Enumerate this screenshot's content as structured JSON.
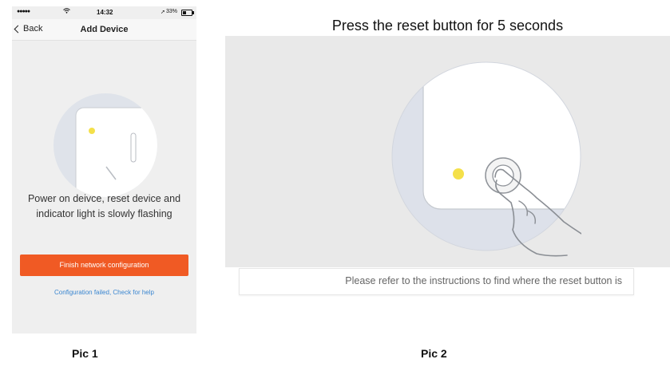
{
  "pic1": {
    "status": {
      "signal": "●●●●●",
      "time": "14:32",
      "battery": "33%"
    },
    "nav": {
      "back_label": "Back",
      "title": "Add Device"
    },
    "message_line1": "Power on deivce, reset device and",
    "message_line2": "indicator light is slowly flashing",
    "finish_button": "Finish network configuration",
    "help_link": "Configuration failed,  Check for help",
    "caption": "Pic 1",
    "accent": "#f05a24",
    "link_color": "#3a86d0",
    "indicator_color": "#f4e04a"
  },
  "pic2": {
    "title": "Press the reset button for 5 seconds",
    "instruction": "Please refer to the instructions to find where the reset button is",
    "caption": "Pic 2"
  }
}
